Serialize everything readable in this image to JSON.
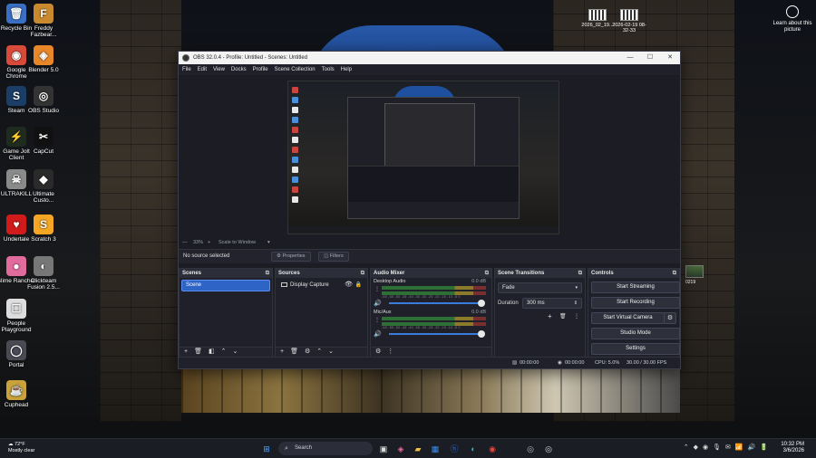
{
  "desktop": {
    "icons": [
      {
        "label": "Recycle Bin",
        "glyph": "🗑",
        "color": "#3a6fc4"
      },
      {
        "label": "Freddy Fazbear...",
        "glyph": "F",
        "color": "#c98a2f"
      },
      {
        "label": "Google Chrome",
        "glyph": "◉",
        "color": "#d84a3a"
      },
      {
        "label": "Blender 5.0",
        "glyph": "◈",
        "color": "#e8862a"
      },
      {
        "label": "Steam",
        "glyph": "S",
        "color": "#1b3e66"
      },
      {
        "label": "OBS Studio",
        "glyph": "◎",
        "color": "#333333"
      },
      {
        "label": "Game Jolt Client",
        "glyph": "⚡",
        "color": "#1f2b1f"
      },
      {
        "label": "CapCut",
        "glyph": "✂",
        "color": "#111111"
      },
      {
        "label": "ULTRAKILL",
        "glyph": "☠",
        "color": "#8a8a8a"
      },
      {
        "label": "Ultimate Custo...",
        "glyph": "◆",
        "color": "#2a2a2a"
      },
      {
        "label": "Undertale",
        "glyph": "♥",
        "color": "#d11b1b"
      },
      {
        "label": "Scratch 3",
        "glyph": "S",
        "color": "#f5a623"
      },
      {
        "label": "Slime Rancher",
        "glyph": "●",
        "color": "#e06b9c"
      },
      {
        "label": "Clickteam Fusion 2.5...",
        "glyph": "◐",
        "color": "#777777"
      },
      {
        "label": "People Playground",
        "glyph": "☐",
        "color": "#dddddd"
      },
      {
        "label": "Portal",
        "glyph": "◯",
        "color": "#4a4a55"
      },
      {
        "label": "Cuphead",
        "glyph": "☕",
        "color": "#c9a23a"
      }
    ],
    "thumbs": [
      "2026_02_19...",
      "2026-02-19 08-32-33"
    ],
    "learn_label": "Learn about this picture"
  },
  "obs": {
    "title": "OBS 32.0.4 - Profile: Untitled - Scenes: Untitled",
    "window_controls": [
      "—",
      "☐",
      "✕"
    ],
    "menu": [
      "File",
      "Edit",
      "View",
      "Docks",
      "Profile",
      "Scene Collection",
      "Tools",
      "Help"
    ],
    "preview": {
      "zoom": "33%",
      "scale_mode": "Scale to Window"
    },
    "source_bar": {
      "no_source": "No source selected",
      "properties": "Properties",
      "filters": "Filters"
    },
    "scenes": {
      "title": "Scenes",
      "items": [
        "Scene"
      ]
    },
    "sources": {
      "title": "Sources",
      "items": [
        "Display Capture"
      ]
    },
    "audio_mixer": {
      "title": "Audio Mixer",
      "channels": [
        {
          "name": "Desktop Audio",
          "db": "0.0 dB"
        },
        {
          "name": "Mic/Aux",
          "db": "0.0 dB"
        }
      ],
      "ticks": "-60 -55 -50 -45 -40 -35 -30 -25 -20 -15 -10 -5 0"
    },
    "transitions": {
      "title": "Scene Transitions",
      "type": "Fade",
      "duration_label": "Duration",
      "duration": "300 ms"
    },
    "controls": {
      "title": "Controls",
      "start_streaming": "Start Streaming",
      "start_recording": "Start Recording",
      "start_virtual_camera": "Start Virtual Camera",
      "studio_mode": "Studio Mode",
      "settings": "Settings"
    },
    "status": {
      "stream_time": "00:00:00",
      "record_time": "00:00:00",
      "cpu": "CPU: 5.0%",
      "fps": "30.00 / 30.00 FPS"
    }
  },
  "taskbar": {
    "weather_temp": "72°F",
    "weather_desc": "Mostly clear",
    "search_placeholder": "Search",
    "time": "10:32 PM",
    "date": "3/6/2026"
  }
}
